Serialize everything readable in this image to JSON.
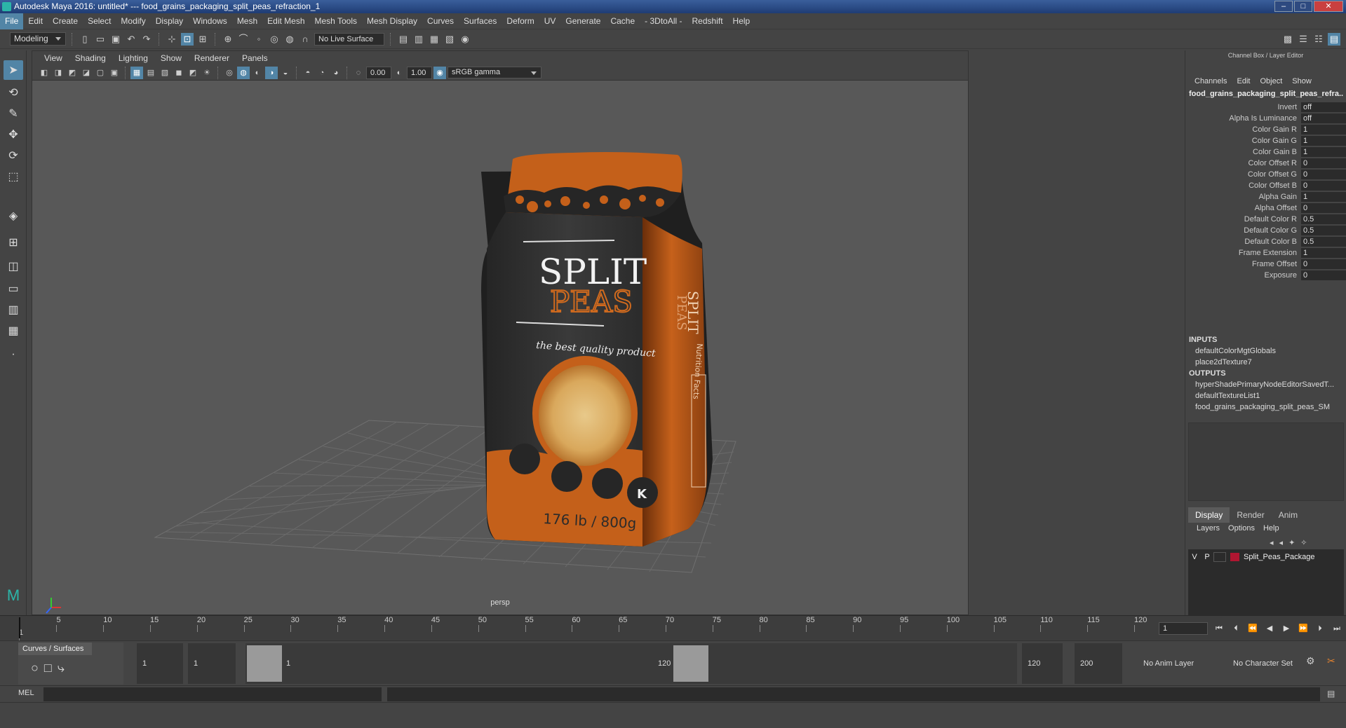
{
  "window": {
    "title": "Autodesk Maya 2016: untitled*   ---   food_grains_packaging_split_peas_refraction_1"
  },
  "menubar": [
    "File",
    "Edit",
    "Create",
    "Select",
    "Modify",
    "Display",
    "Windows",
    "Mesh",
    "Edit Mesh",
    "Mesh Tools",
    "Mesh Display",
    "Curves",
    "Surfaces",
    "Deform",
    "UV",
    "Generate",
    "Cache",
    "- 3DtoAll -",
    "Redshift",
    "Help"
  ],
  "status": {
    "mode": "Modeling",
    "live_surface": "No Live Surface"
  },
  "viewport": {
    "menu": [
      "View",
      "Shading",
      "Lighting",
      "Show",
      "Renderer",
      "Panels"
    ],
    "exposure": "0.00",
    "gamma": "1.00",
    "color_space": "sRGB gamma",
    "camera": "persp"
  },
  "package": {
    "brand_top": "SPLIT",
    "brand_bottom": "PEAS",
    "tagline": "the best quality product",
    "weight": "176 lb / 800g",
    "side_panel": "Nutrition Facts",
    "side_brand": "SPLIT",
    "side_brand2": "PEAS",
    "kosher": "K"
  },
  "channel_box": {
    "title": "Channel Box / Layer Editor",
    "menu": [
      "Channels",
      "Edit",
      "Object",
      "Show"
    ],
    "node": "food_grains_packaging_split_peas_refra...",
    "attributes": [
      {
        "name": "Invert",
        "value": "off"
      },
      {
        "name": "Alpha Is Luminance",
        "value": "off"
      },
      {
        "name": "Color Gain R",
        "value": "1"
      },
      {
        "name": "Color Gain G",
        "value": "1"
      },
      {
        "name": "Color Gain B",
        "value": "1"
      },
      {
        "name": "Color Offset R",
        "value": "0"
      },
      {
        "name": "Color Offset G",
        "value": "0"
      },
      {
        "name": "Color Offset B",
        "value": "0"
      },
      {
        "name": "Alpha Gain",
        "value": "1"
      },
      {
        "name": "Alpha Offset",
        "value": "0"
      },
      {
        "name": "Default Color R",
        "value": "0.5"
      },
      {
        "name": "Default Color G",
        "value": "0.5"
      },
      {
        "name": "Default Color B",
        "value": "0.5"
      },
      {
        "name": "Frame Extension",
        "value": "1"
      },
      {
        "name": "Frame Offset",
        "value": "0"
      },
      {
        "name": "Exposure",
        "value": "0"
      }
    ],
    "inputs_label": "INPUTS",
    "inputs": [
      "defaultColorMgtGlobals",
      "place2dTexture7"
    ],
    "outputs_label": "OUTPUTS",
    "outputs": [
      "hyperShadePrimaryNodeEditorSavedT...",
      "defaultTextureList1",
      "food_grains_packaging_split_peas_SM"
    ]
  },
  "layer_editor": {
    "tabs": [
      "Display",
      "Render",
      "Anim"
    ],
    "menu": [
      "Layers",
      "Options",
      "Help"
    ],
    "layer": {
      "v": "V",
      "p": "P",
      "name": "Split_Peas_Package",
      "color": "#b01631"
    }
  },
  "timeline": {
    "ticks": [
      "5",
      "10",
      "15",
      "20",
      "25",
      "30",
      "35",
      "40",
      "45",
      "50",
      "55",
      "60",
      "65",
      "70",
      "75",
      "80",
      "85",
      "90",
      "95",
      "100",
      "105",
      "110",
      "115",
      "120"
    ],
    "start_mark": "1",
    "current": "1"
  },
  "range": {
    "shelf_tab": "Curves / Surfaces",
    "start": "1",
    "inner_start": "1",
    "slider_start": "1",
    "slider_end": "120",
    "end": "120",
    "anim_end": "200",
    "anim_layer": "No Anim Layer",
    "char_set": "No Character Set"
  },
  "cmd": {
    "label": "MEL"
  }
}
